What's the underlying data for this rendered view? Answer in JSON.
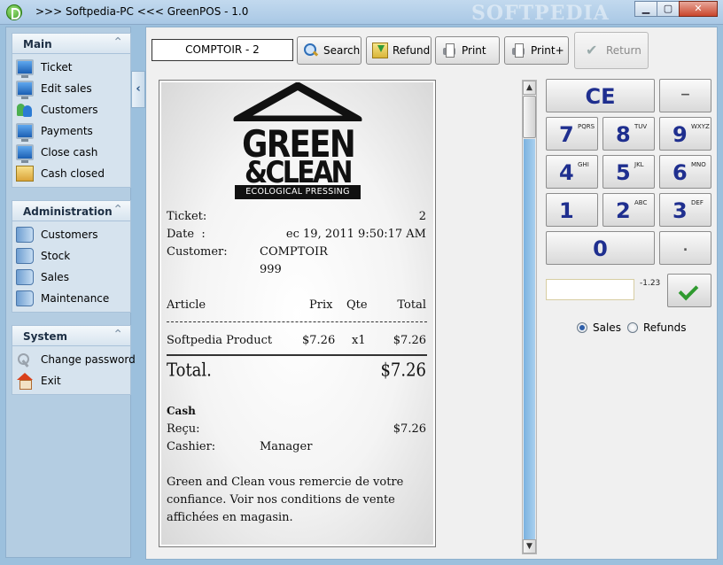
{
  "window": {
    "title": ">>> Softpedia-PC <<< GreenPOS - 1.0",
    "watermark": "SOFTPEDIA",
    "controls": {
      "minimize": "▁",
      "maximize": "▢",
      "close": "✕"
    }
  },
  "sidebar": {
    "collapse_glyph": "‹",
    "groups": [
      {
        "title": "Main",
        "items": [
          {
            "label": "Ticket",
            "icon": "monitor-icon"
          },
          {
            "label": "Edit sales",
            "icon": "monitor-icon"
          },
          {
            "label": "Customers",
            "icon": "users-icon"
          },
          {
            "label": "Payments",
            "icon": "monitor-icon"
          },
          {
            "label": "Close cash",
            "icon": "monitor-icon"
          },
          {
            "label": "Cash closed",
            "icon": "cash-closed-icon"
          }
        ]
      },
      {
        "title": "Administration",
        "items": [
          {
            "label": "Customers",
            "icon": "book-icon"
          },
          {
            "label": "Stock",
            "icon": "book-icon"
          },
          {
            "label": "Sales",
            "icon": "book-icon"
          },
          {
            "label": "Maintenance",
            "icon": "book-icon"
          }
        ]
      },
      {
        "title": "System",
        "items": [
          {
            "label": "Change password",
            "icon": "key-icon"
          },
          {
            "label": "Exit",
            "icon": "home-icon"
          }
        ]
      }
    ]
  },
  "toolbar": {
    "ticket_id": "COMPTOIR - 2",
    "search": "Search",
    "refund": "Refund",
    "print": "Print",
    "print_plus": "Print+",
    "return": "Return"
  },
  "receipt": {
    "logo": {
      "line1": "GREEN",
      "line2": "&CLEAN",
      "tagline": "ECOLOGICAL PRESSING"
    },
    "ticket_label": "Ticket:",
    "ticket_value": "2",
    "date_label": "Date  :",
    "date_value": "ec 19, 2011 9:50:17 AM",
    "customer_label": "Customer:",
    "customer_name": "COMPTOIR",
    "customer_id": "999",
    "headers": {
      "article": "Article",
      "prix": "Prix",
      "qte": "Qte",
      "total": "Total"
    },
    "items": [
      {
        "article": "Softpedia Product",
        "prix": "$7.26",
        "qte": "x1",
        "total": "$7.26"
      }
    ],
    "total_label": "Total.",
    "total_value": "$7.26",
    "payment_type": "Cash",
    "recu_label": "Reçu:",
    "recu_value": "$7.26",
    "cashier_label": "Cashier:",
    "cashier_value": "Manager",
    "footer": [
      "Green and Clean vous remercie de votre",
      "confiance. Voir nos conditions de vente",
      "affichées en magasin."
    ]
  },
  "keypad": {
    "ce": "CE",
    "minus": "−",
    "keys": [
      {
        "digit": "7",
        "letters": "PQRS"
      },
      {
        "digit": "8",
        "letters": "TUV"
      },
      {
        "digit": "9",
        "letters": "WXYZ"
      },
      {
        "digit": "4",
        "letters": "GHI"
      },
      {
        "digit": "5",
        "letters": "JKL"
      },
      {
        "digit": "6",
        "letters": "MNO"
      },
      {
        "digit": "1",
        "letters": ""
      },
      {
        "digit": "2",
        "letters": "ABC"
      },
      {
        "digit": "3",
        "letters": "DEF"
      }
    ],
    "zero": "0",
    "dot": ".",
    "amount_value": "",
    "amount_side_label": "-1.23"
  },
  "mode": {
    "sales": "Sales",
    "refunds": "Refunds",
    "selected": "sales"
  },
  "colors": {
    "accent": "#1f2f8f",
    "ok": "#2f9a2f",
    "sidebar": "#b4cde2"
  }
}
